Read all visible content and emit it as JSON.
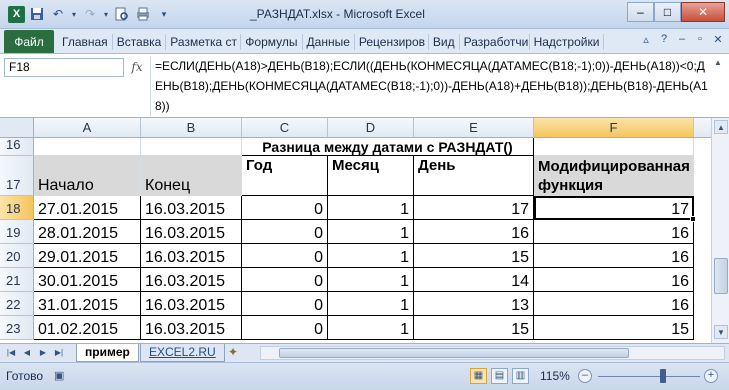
{
  "title_bar": {
    "title": "_РАЗНДАТ.xlsx  -  Microsoft Excel",
    "app_icon": "X",
    "qat_icons": [
      "save-icon",
      "undo-icon",
      "redo-icon",
      "print-preview-icon",
      "print-icon",
      "customize-icon"
    ],
    "window_buttons": {
      "minimize": "–",
      "maximize": "□",
      "close": "✕"
    }
  },
  "ribbon": {
    "file_tab": "Файл",
    "tabs": [
      "Главная",
      "Вставка",
      "Разметка ст",
      "Формулы",
      "Данные",
      "Рецензиров",
      "Вид",
      "Разработчи",
      "Надстройки"
    ]
  },
  "formula_bar": {
    "name_box": "F18",
    "fx_label": "fx",
    "formula": "=ЕСЛИ(ДЕНЬ(A18)>ДЕНЬ(B18);ЕСЛИ((ДЕНЬ(КОНМЕСЯЦА(ДАТАМЕС(B18;-1);0))-ДЕНЬ(A18))<0;ДЕНЬ(B18);ДЕНЬ(КОНМЕСЯЦА(ДАТАМЕС(B18;-1);0))-ДЕНЬ(A18)+ДЕНЬ(B18));ДЕНЬ(B18)-ДЕНЬ(A18))"
  },
  "sheet": {
    "columns": [
      "A",
      "B",
      "C",
      "D",
      "E",
      "F"
    ],
    "row_numbers": [
      "16",
      "17",
      "18",
      "19",
      "20",
      "21",
      "22",
      "23"
    ],
    "merged_title": "Разница между датами с РАЗНДАТ()",
    "headers": {
      "a": "Начало",
      "b": "Конец",
      "c": "Год",
      "d": "Месяц",
      "e": "День",
      "f": "Модифицированная функция"
    },
    "rows": [
      {
        "a": "27.01.2015",
        "b": "16.03.2015",
        "c": "0",
        "d": "1",
        "e": "17",
        "f": "17"
      },
      {
        "a": "28.01.2015",
        "b": "16.03.2015",
        "c": "0",
        "d": "1",
        "e": "16",
        "f": "16"
      },
      {
        "a": "29.01.2015",
        "b": "16.03.2015",
        "c": "0",
        "d": "1",
        "e": "15",
        "f": "16"
      },
      {
        "a": "30.01.2015",
        "b": "16.03.2015",
        "c": "0",
        "d": "1",
        "e": "14",
        "f": "16"
      },
      {
        "a": "31.01.2015",
        "b": "16.03.2015",
        "c": "0",
        "d": "1",
        "e": "13",
        "f": "16"
      },
      {
        "a": "01.02.2015",
        "b": "16.03.2015",
        "c": "0",
        "d": "1",
        "e": "15",
        "f": "15"
      }
    ],
    "active_cell": "F18"
  },
  "sheet_tabs": {
    "active": "пример",
    "other": "EXCEL2.RU"
  },
  "status_bar": {
    "status": "Готово",
    "zoom": "115%"
  }
}
